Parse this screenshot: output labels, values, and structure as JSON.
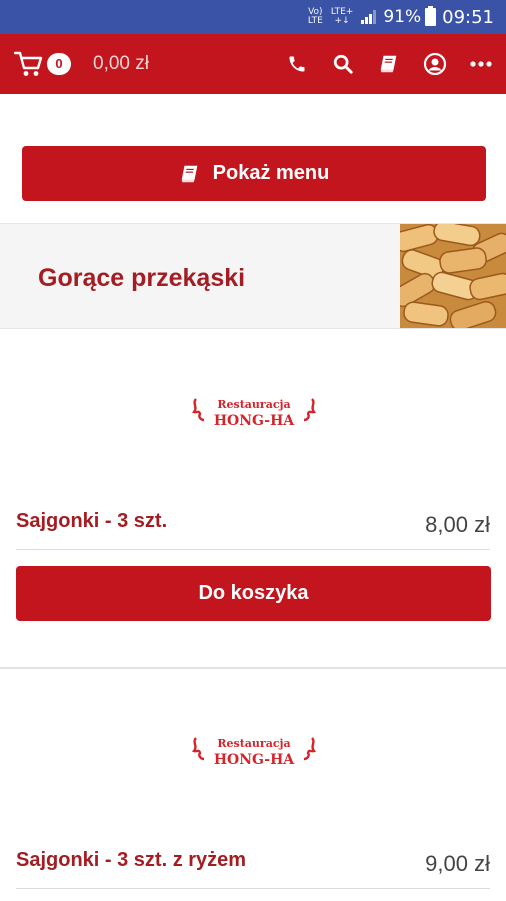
{
  "status_bar": {
    "network_top": "Vo)",
    "network_bottom": "LTE",
    "lte_top": "LTE+",
    "lte_bottom": "+↓",
    "battery": "91%",
    "time": "09:51"
  },
  "header": {
    "cart_count": "0",
    "cart_total": "0,00 zł",
    "icons": [
      "phone-icon",
      "search-icon",
      "book-icon",
      "account-icon",
      "more-icon"
    ]
  },
  "show_menu_label": "Pokaż menu",
  "category": {
    "title": "Gorące przekąski"
  },
  "logo": {
    "line1": "Restauracja",
    "line2": "HONG-HA"
  },
  "products": [
    {
      "name": "Sajgonki - 3 szt.",
      "price": "8,00 zł",
      "button": "Do koszyka"
    },
    {
      "name": "Sajgonki - 3 szt. z ryżem",
      "price": "9,00 zł"
    }
  ],
  "colors": {
    "status_bar": "#3b53a6",
    "brand_red": "#c2151d",
    "title_red": "#a31d22"
  }
}
